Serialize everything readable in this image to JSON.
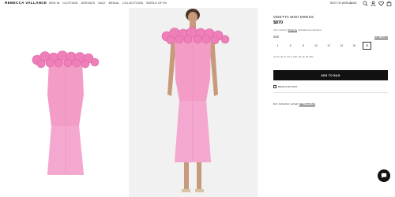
{
  "header": {
    "logo": "REBECCA VALLANCE",
    "nav": [
      "NEW IN",
      "CLOTHING",
      "DRESSES",
      "SALE",
      "BRIDAL",
      "COLLECTIONS",
      "WORLD OF RV"
    ],
    "region": "REST OF WORLD",
    "currency": "$USD",
    "icons": [
      "search-icon",
      "account-icon",
      "wishlist-icon",
      "bag-icon"
    ]
  },
  "product": {
    "title": "ODETTA MIDI DRESS",
    "price": "$870",
    "tax_prefix": "Tax included. ",
    "tax_link": "Shipping",
    "tax_suffix": " calculated at checkout.",
    "size_label": "SIZE",
    "size_guide": "SIZE GUIDE",
    "sizes": [
      "4",
      "6",
      "8",
      "10",
      "12",
      "14",
      "16",
      "18"
    ],
    "selected_size": "18",
    "uk_sizes": "AU: 8, UK: 8, US: 4 | EU: 36 | IT: 40 (XS)",
    "add_to_bag": "ADD TO BAG",
    "book_stylist": "BOOK A STYLIST",
    "pay_later_prefix": "BUY NOW PAY LATER. ",
    "pay_later_link": "SEE OPTIONS"
  },
  "colors": {
    "dress_pink": "#f29cc6",
    "dress_shadow": "#e583b3",
    "ruffle_pink": "#ee7fb8",
    "button_black": "#111111",
    "backdrop": "#f1f1f1"
  }
}
